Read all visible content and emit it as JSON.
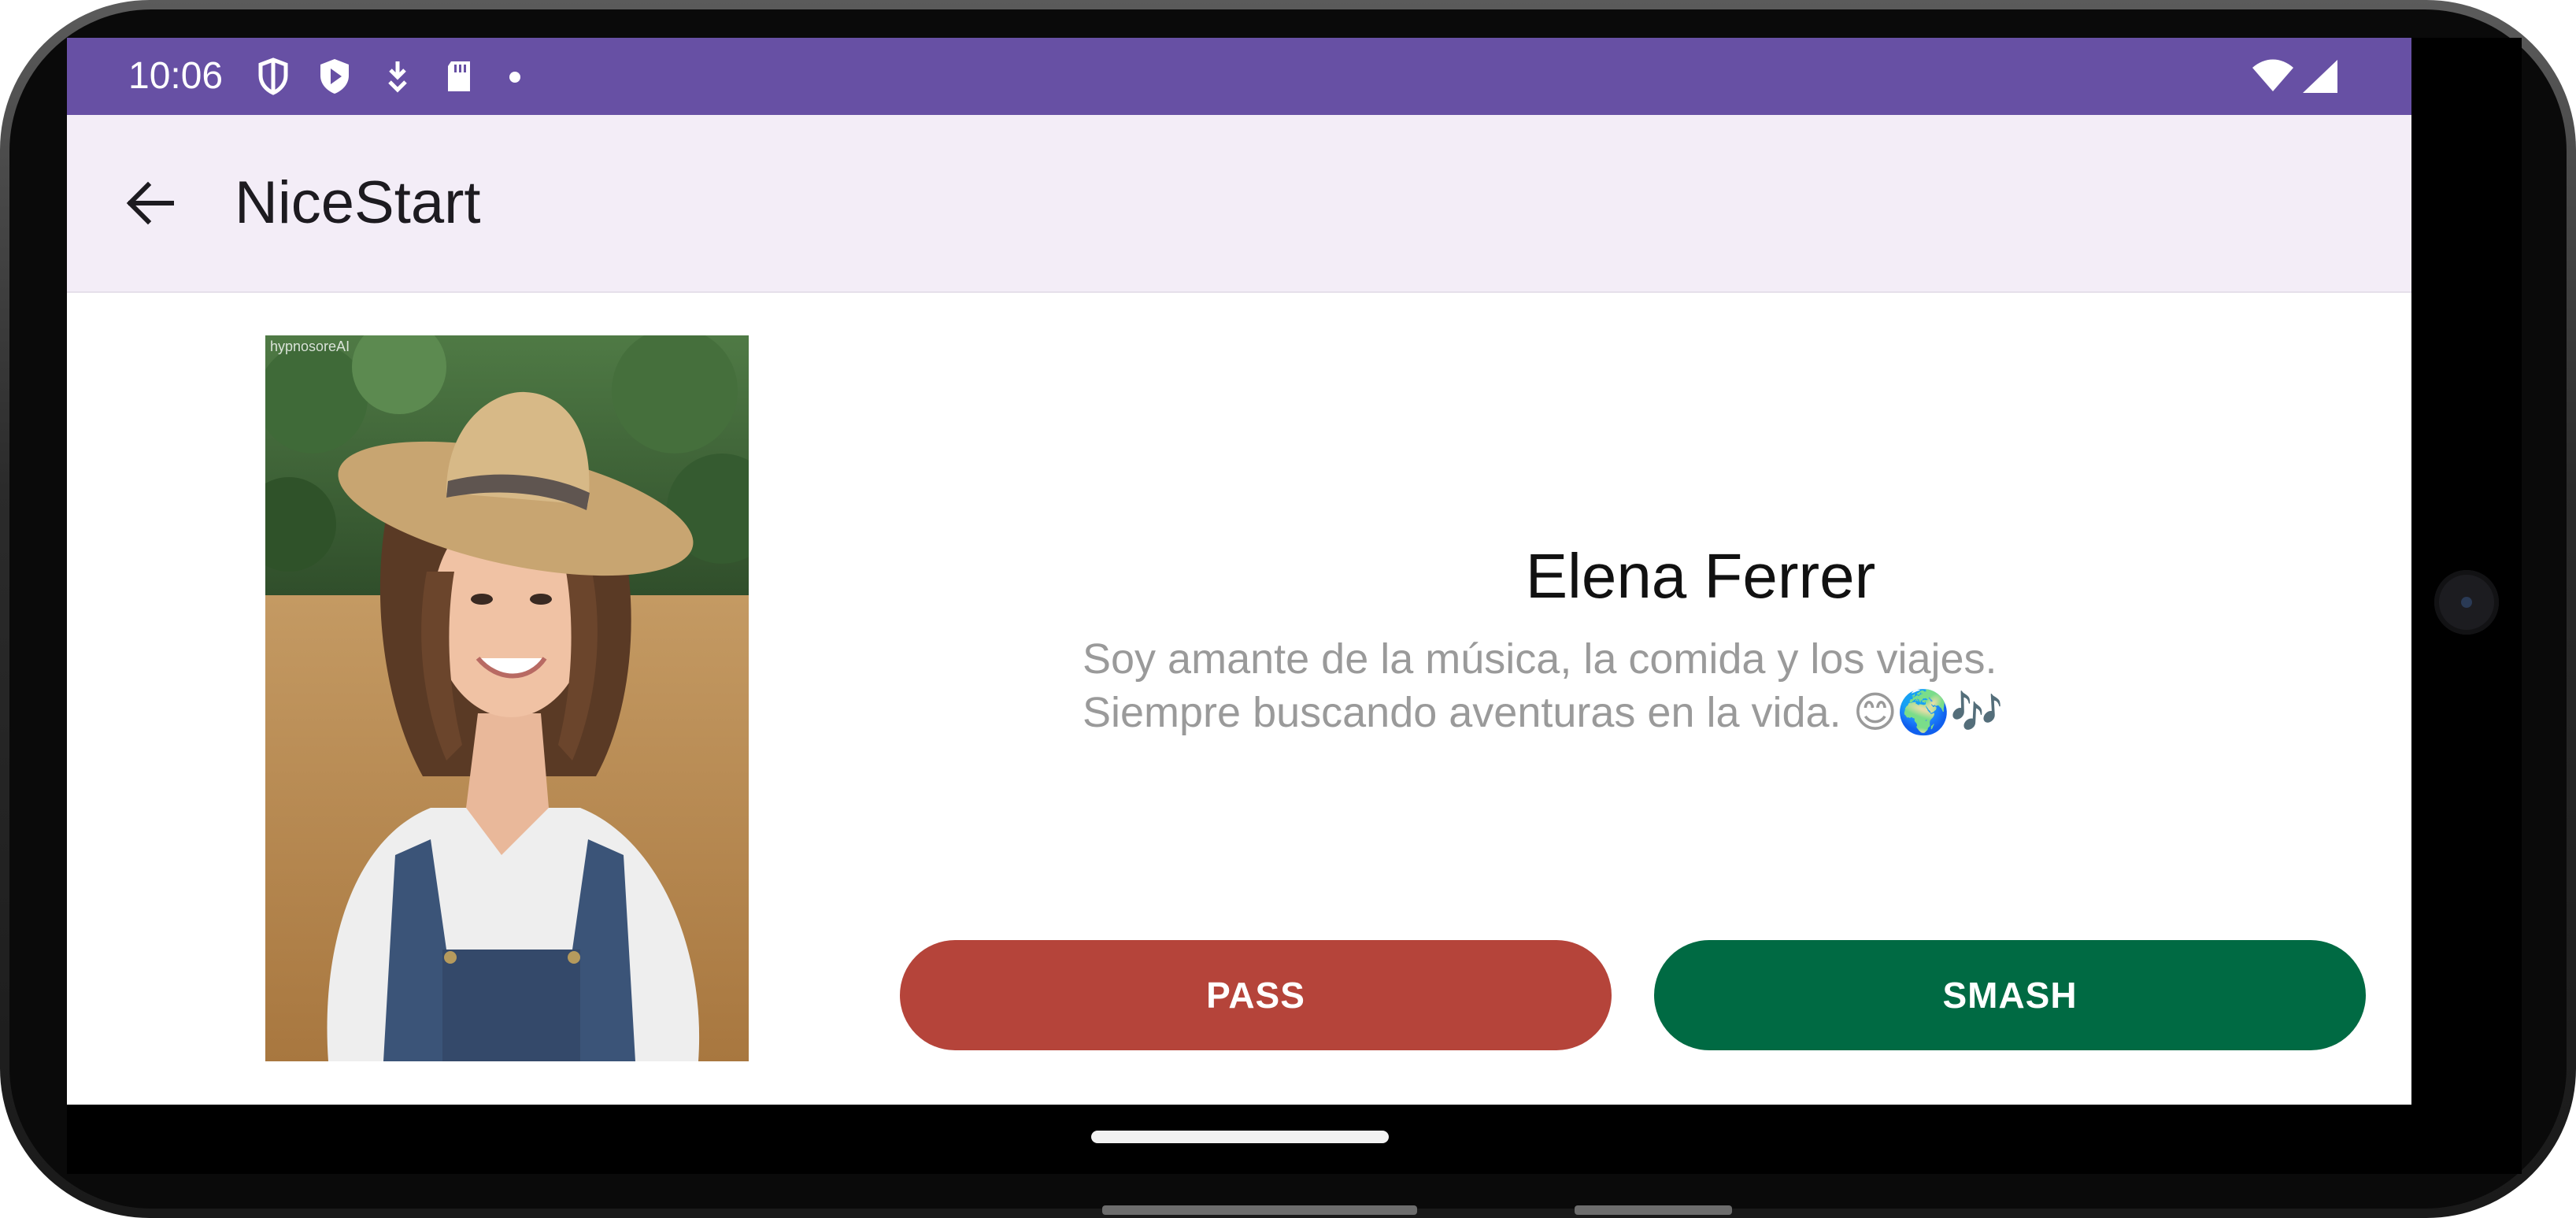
{
  "status_bar": {
    "time": "10:06",
    "icons_left": [
      "shield-icon",
      "play-protect-icon",
      "download-icon",
      "sd-card-icon",
      "dot-icon"
    ],
    "icons_right": [
      "wifi-icon",
      "signal-icon"
    ],
    "background": "#6750a4"
  },
  "app_bar": {
    "title": "NiceStart",
    "back_icon": "arrow-left-icon",
    "background": "#f3edf7"
  },
  "profile": {
    "photo_watermark": "hypnosoreAI",
    "name": "Elena Ferrer",
    "bio_line_1": "Soy amante de la música, la comida y los viajes.",
    "bio_line_2": "Siempre buscando aventuras en la vida. 😊🌍🎶"
  },
  "actions": {
    "pass_label": "PASS",
    "pass_color": "#b5443a",
    "smash_label": "SMASH",
    "smash_color": "#006a43"
  }
}
